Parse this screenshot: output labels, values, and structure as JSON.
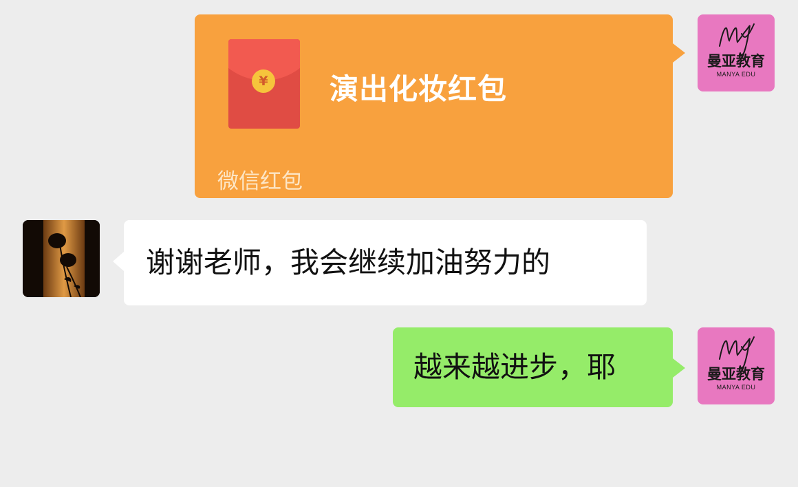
{
  "chat": {
    "teacher": {
      "brand_name": "曼亚教育",
      "brand_sub": "MANYA EDU"
    },
    "red_packet": {
      "coin_symbol": "¥",
      "title": "演出化妆红包",
      "footer": "微信红包"
    },
    "incoming_message": "谢谢老师，我会继续加油努力的",
    "outgoing_message": "越来越进步，耶"
  },
  "colors": {
    "background": "#ededed",
    "red_packet_bg": "#f8a13e",
    "outgoing_bubble": "#95ec69",
    "incoming_bubble": "#ffffff",
    "brand_avatar": "#e878c0"
  }
}
